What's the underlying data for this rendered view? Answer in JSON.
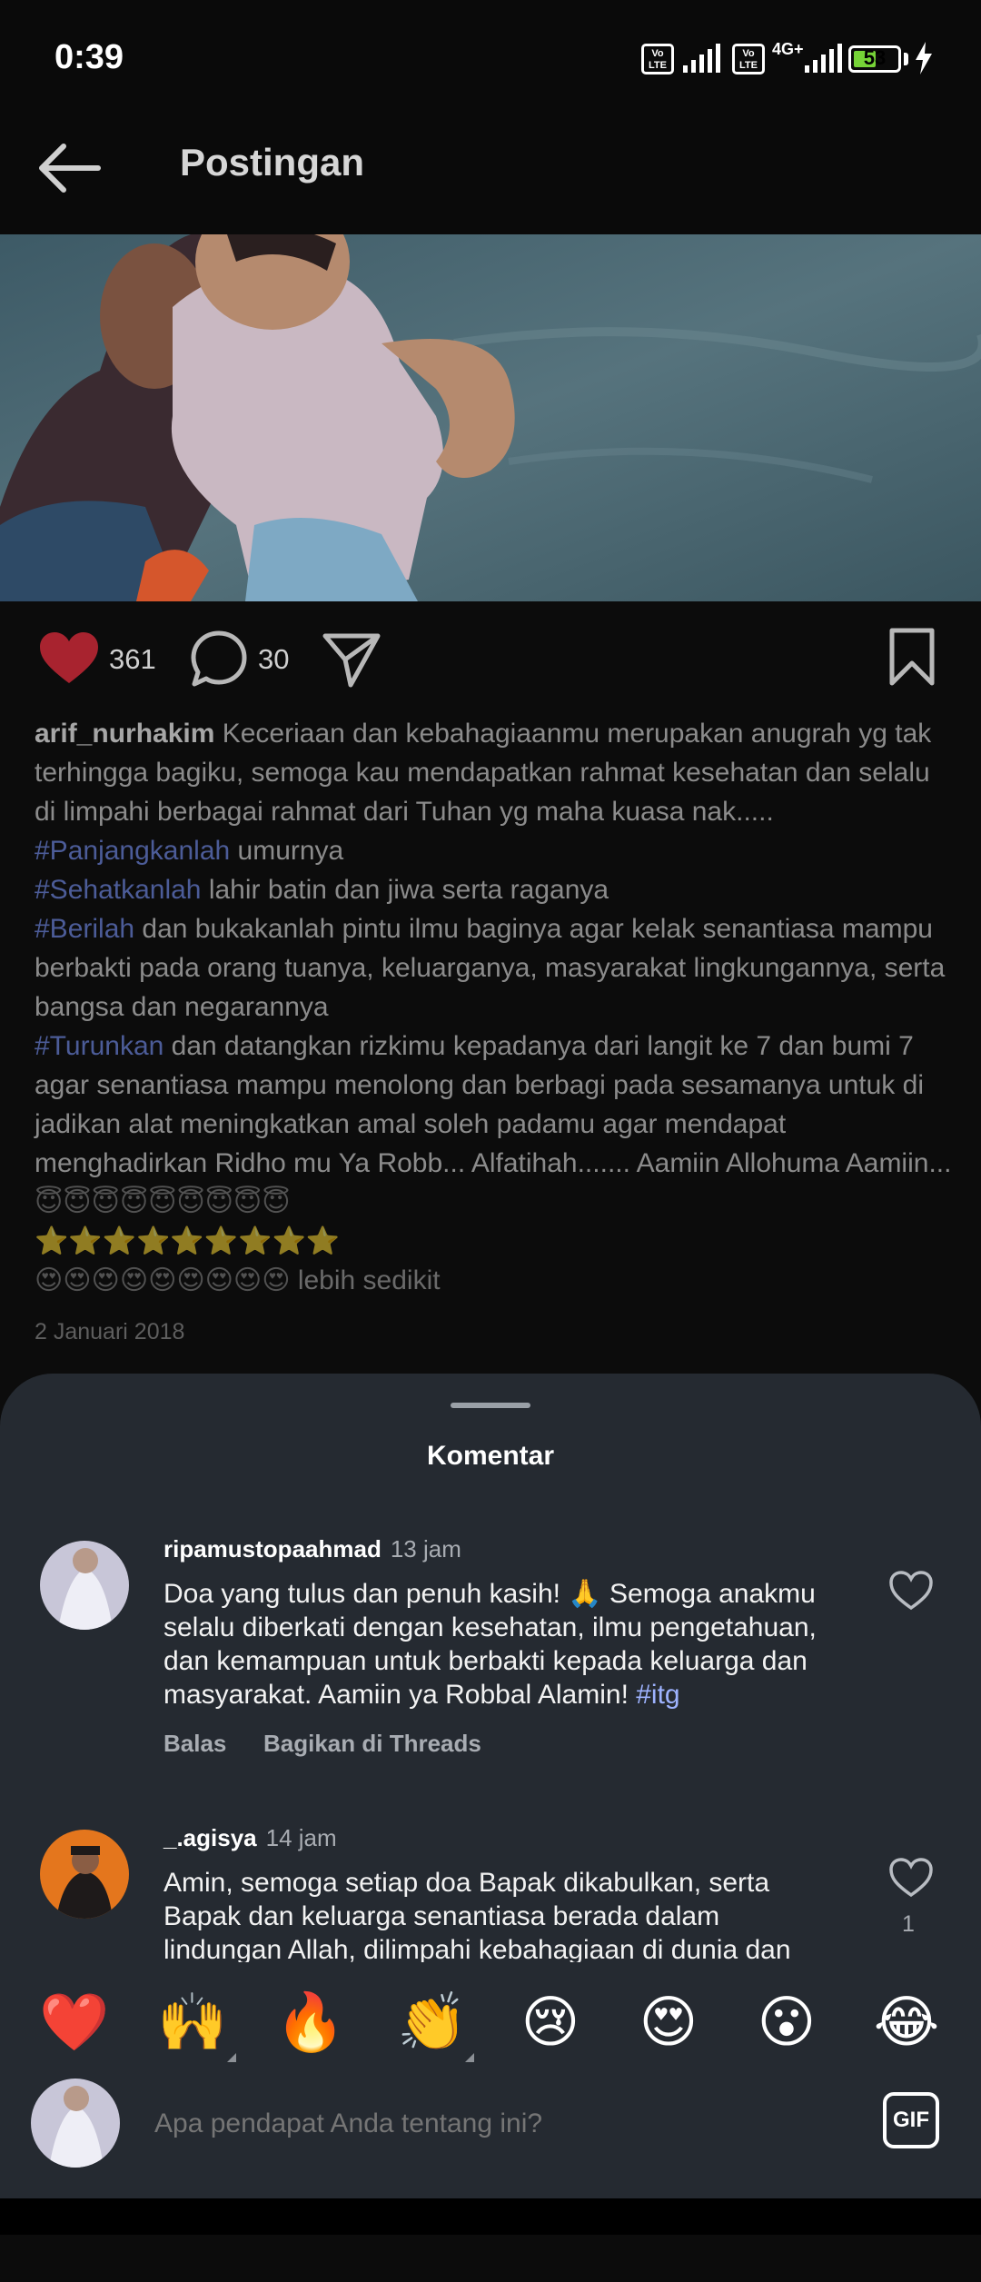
{
  "status_bar": {
    "time": "0:39",
    "sim1_badge": "Vo LTE",
    "sim2_badge": "Vo LTE",
    "network": "4G+",
    "battery": "53",
    "battery_level": 0.53,
    "charging_icon": "lightning-icon"
  },
  "header": {
    "back_icon": "arrow-left-icon",
    "title": "Postingan"
  },
  "post": {
    "photo_alt": "photo",
    "likes": "361",
    "comments": "30",
    "liked": true,
    "caption": {
      "username": "arif_nurhakim",
      "line1": " Keceriaan dan kebahagiaanmu merupakan anugrah yg tak terhingga bagiku,  semoga kau mendapatkan rahmat kesehatan dan selalu di limpahi berbagai rahmat dari Tuhan yg maha kuasa nak.....",
      "tag1": "#Panjangkanlah",
      "text1": " umurnya",
      "tag2": "#Sehatkanlah",
      "text2": " lahir batin dan jiwa serta raganya",
      "tag3": "#Berilah",
      "text3": " dan bukakanlah pintu ilmu baginya agar kelak senantiasa mampu berbakti pada orang tuanya,  keluarganya,  masyarakat lingkungannya,  serta bangsa dan negarannya",
      "tag4": "#Turunkan",
      "text4": " dan datangkan rizkimu kepadanya dari langit ke 7 dan bumi 7 agar senantiasa mampu menolong dan berbagi pada sesamanya untuk di jadikan alat meningkatkan amal soleh padamu agar mendapat menghadirkan Ridho mu Ya Robb... Alfatihah....... Aamiin Allohuma Aamiin... ",
      "emoji_halo": "😇😇😇😇😇😇😇😇😇",
      "emoji_stars": "⭐⭐⭐⭐⭐⭐⭐⭐⭐",
      "emoji_hearts": "😍😍😍😍😍😍😍😍😍",
      "less_label": "lebih sedikit"
    },
    "date": "2 Januari 2018"
  },
  "comments_sheet": {
    "title": "Komentar",
    "comments": [
      {
        "username": "ripamustopaahmad",
        "time": "13 jam",
        "text": "Doa yang tulus dan penuh kasih! 🙏 Semoga anakmu selalu diberkati dengan kesehatan, ilmu pengetahuan, dan kemampuan untuk berbakti kepada keluarga dan masyarakat. Aamiin ya Robbal Alamin! ",
        "tag": "#itg",
        "reply_label": "Balas",
        "share_label": "Bagikan di Threads"
      },
      {
        "username": "_.agisya",
        "time": "14 jam",
        "text": "Amin, semoga setiap doa Bapak dikabulkan, serta Bapak dan keluarga senantiasa berada dalam lindungan Allah, dilimpahi kebahagiaan di dunia dan",
        "likes": "1"
      }
    ]
  },
  "reactions": [
    "❤️",
    "🙌",
    "🔥",
    "👏",
    "😢",
    "😍",
    "😮",
    "😂"
  ],
  "input": {
    "placeholder": "Apa pendapat Anda tentang ini?",
    "gif_label": "GIF"
  },
  "colors": {
    "background": "#000000",
    "sheet": "#252a31",
    "like_red": "#ed3c4d",
    "hashtag": "#9eb3ff",
    "battery_green": "#76d337"
  }
}
